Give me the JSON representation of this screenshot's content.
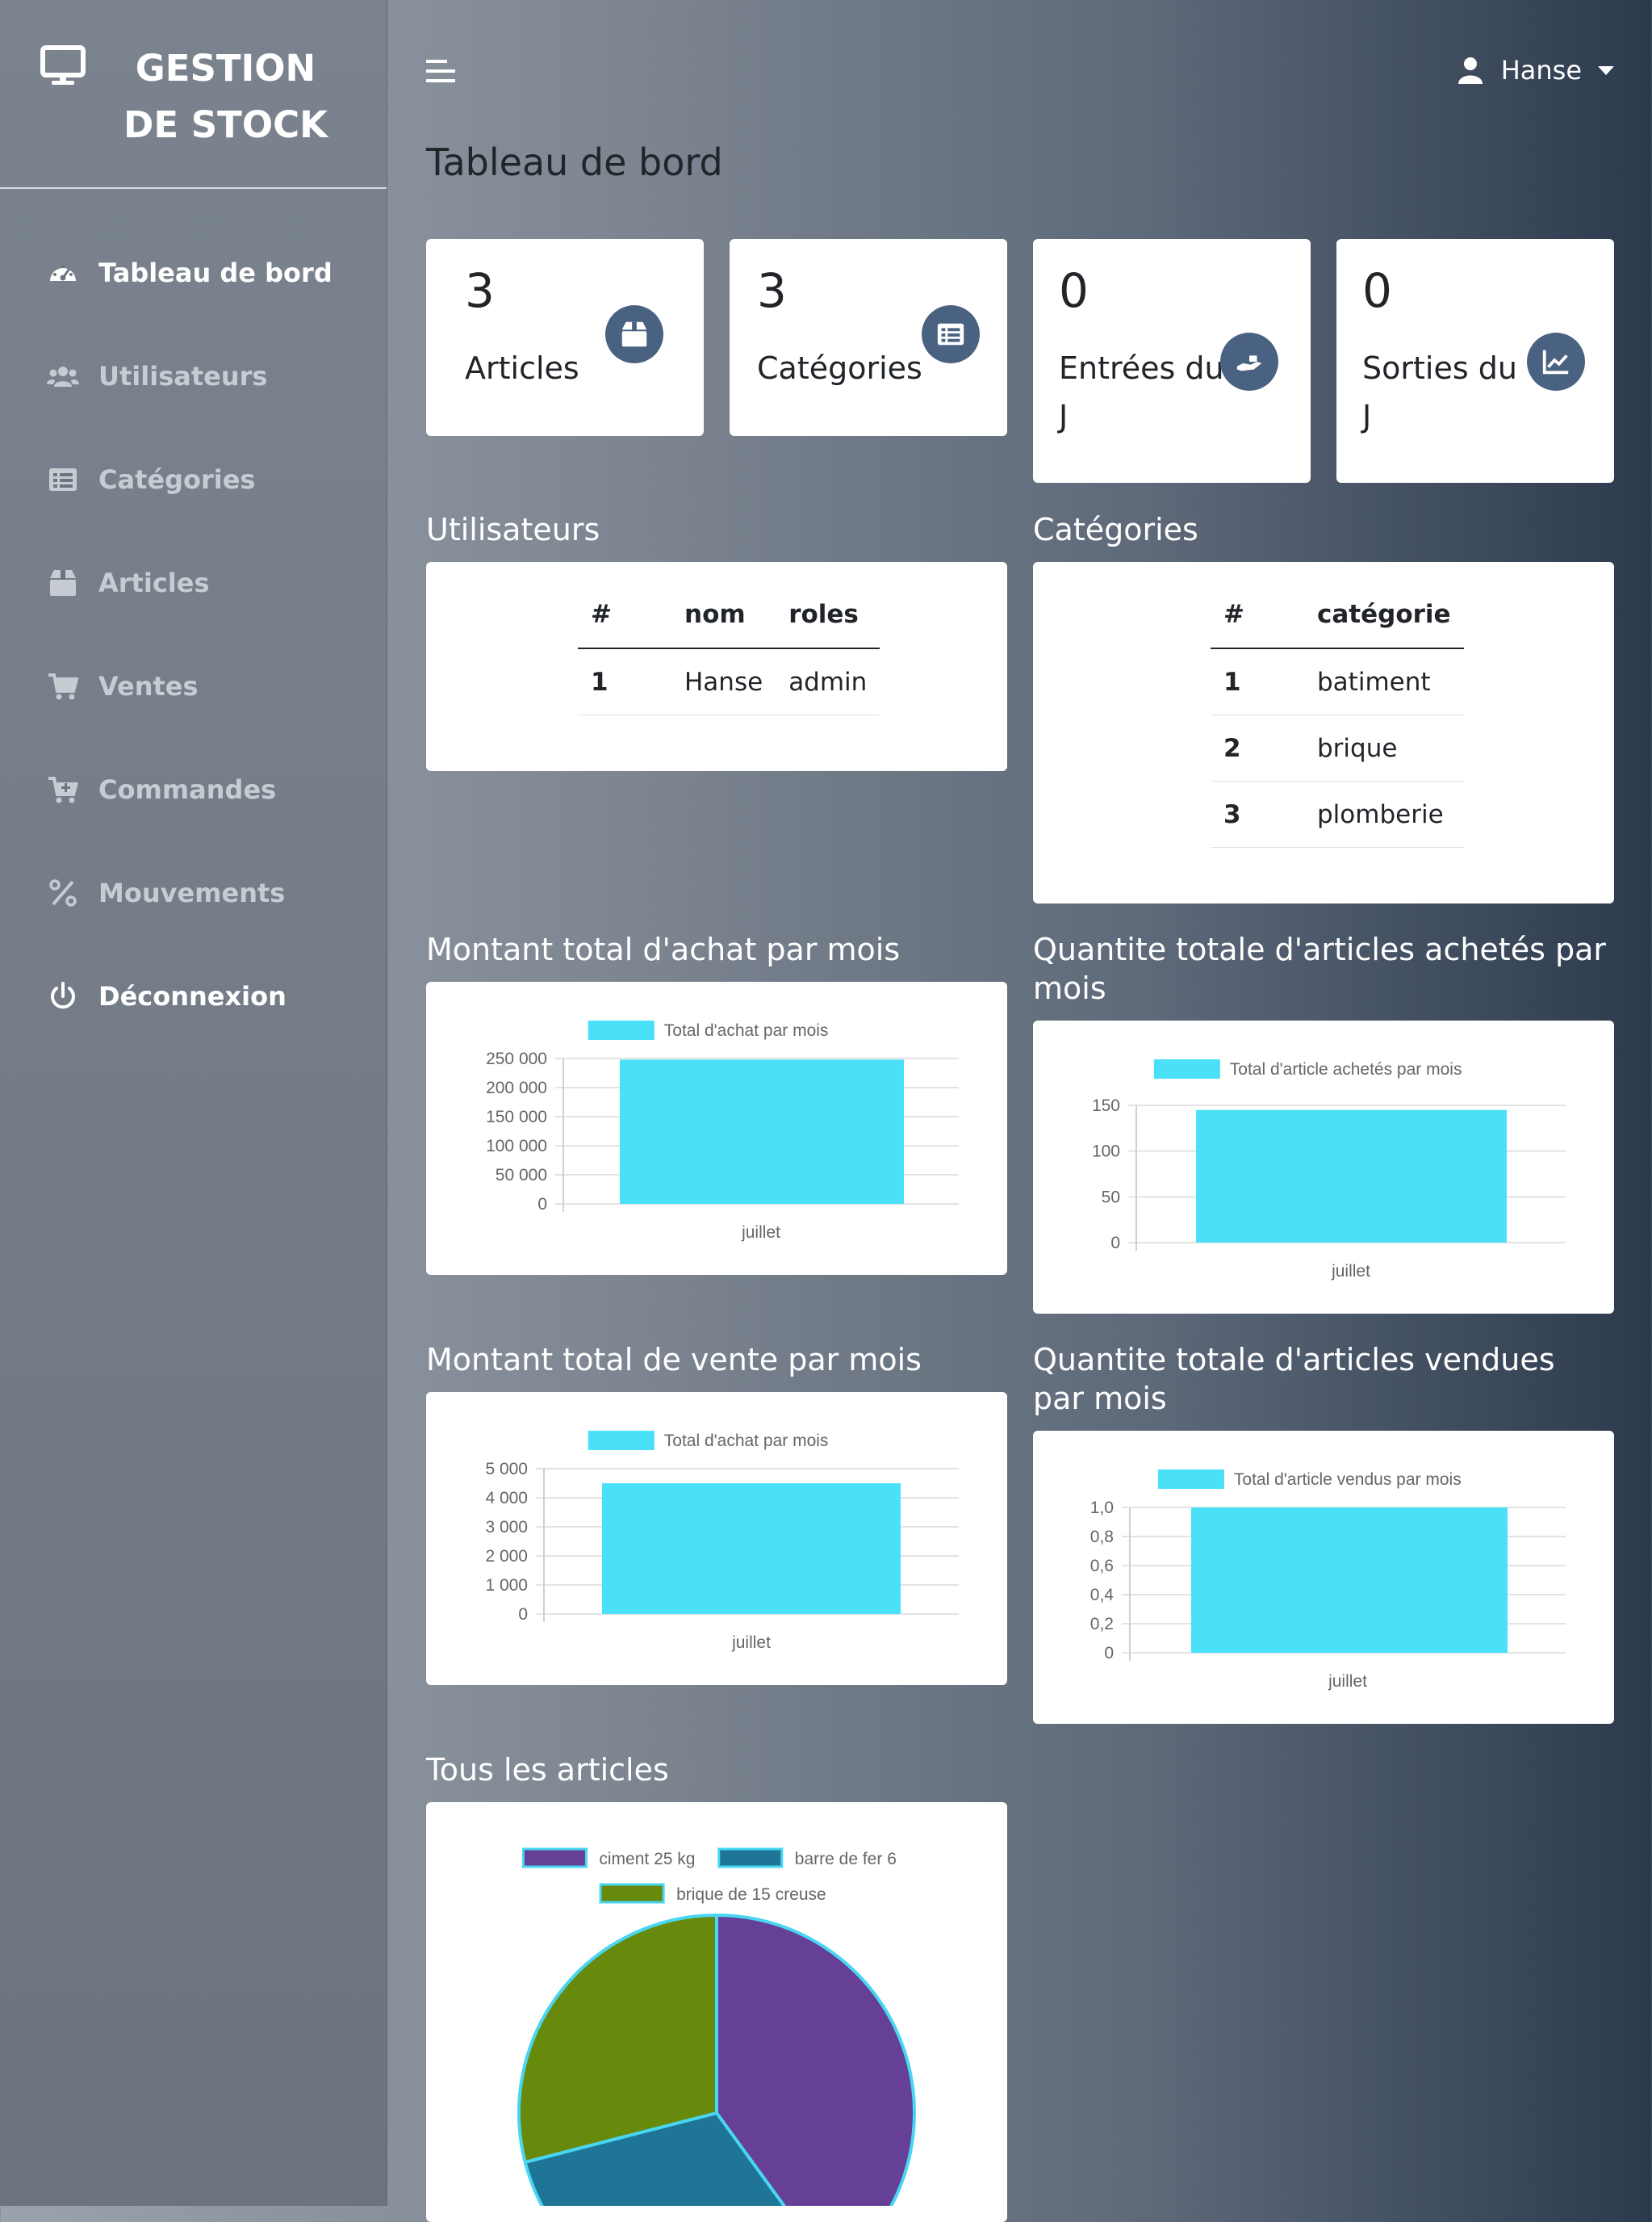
{
  "app": {
    "brand": "GESTION DE STOCK",
    "page_title": "Tableau de bord"
  },
  "sidebar": {
    "items": [
      {
        "label": "Tableau de bord",
        "icon": "gauge-icon"
      },
      {
        "label": "Utilisateurs",
        "icon": "users-icon"
      },
      {
        "label": "Catégories",
        "icon": "list-icon"
      },
      {
        "label": "Articles",
        "icon": "box-icon"
      },
      {
        "label": "Ventes",
        "icon": "cart-icon"
      },
      {
        "label": "Commandes",
        "icon": "cart-plus-icon"
      },
      {
        "label": "Mouvements",
        "icon": "percent-icon"
      },
      {
        "label": "Déconnexion",
        "icon": "power-icon"
      }
    ]
  },
  "topbar": {
    "user": "Hanse"
  },
  "stats": [
    {
      "value": "3",
      "label": "Articles",
      "icon": "box-icon"
    },
    {
      "value": "3",
      "label": "Catégories",
      "icon": "list-icon"
    },
    {
      "value": "0",
      "label": "Entrées du J",
      "icon": "hand-icon"
    },
    {
      "value": "0",
      "label": "Sorties du J",
      "icon": "chart-line-icon"
    }
  ],
  "users_section": {
    "title": "Utilisateurs",
    "headers": [
      "#",
      "nom",
      "roles"
    ],
    "rows": [
      [
        "1",
        "Hanse",
        "admin"
      ]
    ]
  },
  "categories_section": {
    "title": "Catégories",
    "headers": [
      "#",
      "catégorie"
    ],
    "rows": [
      [
        "1",
        "batiment"
      ],
      [
        "2",
        "brique"
      ],
      [
        "3",
        "plomberie"
      ]
    ]
  },
  "charts": {
    "achat_montant": {
      "title": "Montant total d'achat par mois"
    },
    "achat_quantite": {
      "title": "Quantite totale d'articles achetés par mois"
    },
    "vente_montant": {
      "title": "Montant total de vente par mois"
    },
    "vente_quantite": {
      "title": "Quantite totale d'articles vendues par mois"
    },
    "articles": {
      "title": "Tous les articles"
    }
  },
  "colors": {
    "bar": "#49e0f8",
    "icon_bg": "#4a6282",
    "pie": [
      "#663f96",
      "#1f7596",
      "#678a0c"
    ],
    "pie_border": "#49d6f2"
  },
  "chart_data": [
    {
      "type": "bar",
      "legend": "Total d'achat par mois",
      "categories": [
        "juillet"
      ],
      "values": [
        248000
      ],
      "ylim": [
        0,
        250000
      ],
      "yticks": [
        "250 000",
        "200 000",
        "150 000",
        "100 000",
        "50 000",
        "0"
      ],
      "ytick_values": [
        250000,
        200000,
        150000,
        100000,
        50000,
        0
      ]
    },
    {
      "type": "bar",
      "legend": "Total d'article achetés par mois",
      "categories": [
        "juillet"
      ],
      "values": [
        145
      ],
      "ylim": [
        0,
        150
      ],
      "yticks": [
        "150",
        "100",
        "50",
        "0"
      ],
      "ytick_values": [
        150,
        100,
        50,
        0
      ]
    },
    {
      "type": "bar",
      "legend": "Total d'achat par mois",
      "categories": [
        "juillet"
      ],
      "values": [
        4500
      ],
      "ylim": [
        0,
        5000
      ],
      "yticks": [
        "5 000",
        "4 000",
        "3 000",
        "2 000",
        "1 000",
        "0"
      ],
      "ytick_values": [
        5000,
        4000,
        3000,
        2000,
        1000,
        0
      ]
    },
    {
      "type": "bar",
      "legend": "Total d'article vendus par mois",
      "categories": [
        "juillet"
      ],
      "values": [
        1
      ],
      "ylim": [
        0,
        1
      ],
      "yticks": [
        "1,0",
        "0,8",
        "0,6",
        "0,4",
        "0,2",
        "0"
      ],
      "ytick_values": [
        1,
        0.8,
        0.6,
        0.4,
        0.2,
        0
      ]
    },
    {
      "type": "pie",
      "legend": [
        "ciment 25 kg",
        "barre de fer 6",
        "brique de 15 creuse"
      ],
      "values": [
        40,
        31,
        29
      ]
    }
  ]
}
